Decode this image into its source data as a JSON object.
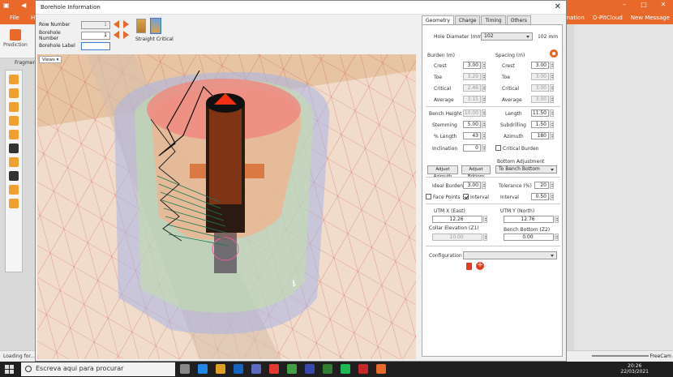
{
  "app": {
    "file_label": "File",
    "home_label": "H",
    "right_items": [
      "Information",
      "O-PitCloud",
      "New Message"
    ],
    "prediction_label": "Prediction",
    "fragment_label": "Fragmen",
    "status_left": "Loading for...",
    "status_right": "FreeCam"
  },
  "taskbar": {
    "search_placeholder": "Escreva aqui para procurar",
    "time": "20:26",
    "date": "22/03/2021"
  },
  "dialog": {
    "title": "Borehole Information",
    "row_number_label": "Row Number",
    "row_number_value": "1",
    "borehole_number_label": "Borehole Number",
    "borehole_number_value": "1",
    "borehole_label_label": "Borehole Label",
    "borehole_label_value": "",
    "hole_types": [
      "Straight",
      "Critical"
    ],
    "views_label": "Views"
  },
  "geometry": {
    "tabs": [
      "Geometry",
      "Charge",
      "Timing",
      "Others"
    ],
    "hole_diameter_label": "Hole Diameter (mm)",
    "hole_diameter_value": "102",
    "hole_diameter_unit": "102 mm",
    "burden_header": "Burden (m)",
    "spacing_header": "Spacing (m)",
    "burden": {
      "crest": "3.00",
      "toe": "3.29",
      "critical": "2.46",
      "average": "3.15"
    },
    "spacing": {
      "crest": "3.00",
      "toe": "3.00",
      "critical": "3.00",
      "average": "3.00"
    },
    "labels": {
      "crest": "Crest",
      "toe": "Toe",
      "critical": "Critical",
      "average": "Average"
    },
    "bench_height_label": "Bench Height",
    "bench_height_value": "10.00",
    "length_label": "Length",
    "length_value": "11.50",
    "stemming_label": "Stemming",
    "stemming_value": "5.00",
    "subdrilling_label": "Subdrilling",
    "subdrilling_value": "1.50",
    "pct_length_label": "% Length",
    "pct_length_value": "43",
    "azimuth_label": "Azimuth",
    "azimuth_value": "180",
    "inclination_label": "Inclination",
    "inclination_value": "0",
    "critical_burden_label": "Critical Burden",
    "bottom_adjustment_label": "Bottom Adjustment",
    "adjust_azimuth_label": "Adjust Azimuth",
    "adjust_bottom_label": "Adjust Bottom",
    "bottom_adjustment_value": "To Bench Bottom",
    "ideal_burden_label": "Ideal Burden",
    "ideal_burden_value": "3.00",
    "tolerance_label": "Tolerance (%)",
    "tolerance_value": "20",
    "face_points_label": "Face Points",
    "interval_check_label": "Interval",
    "interval_label": "Interval",
    "interval_value": "0.50",
    "utm_x_label": "UTM X (East)",
    "utm_x_value": "12.26",
    "utm_y_label": "UTM Y (North)",
    "utm_y_value": "12.76",
    "collar_label": "Collar Elevation (Z1)",
    "collar_value": "10.00",
    "bench_bottom_label": "Bench Bottom (Z2)",
    "bench_bottom_value": "0.00",
    "configuration_label": "Configuration",
    "configuration_value": ""
  }
}
